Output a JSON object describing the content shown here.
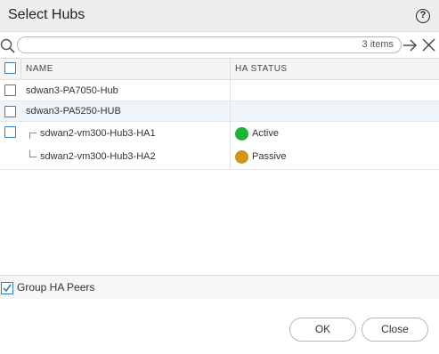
{
  "dialog": {
    "title": "Select Hubs",
    "help_glyph": "?"
  },
  "search": {
    "value": "",
    "placeholder": "",
    "count": "3 items"
  },
  "grid": {
    "columns": [
      "NAME",
      "HA STATUS"
    ],
    "rows": [
      {
        "name": "sdwan3-PA7050-Hub",
        "status": ""
      },
      {
        "name": "sdwan3-PA5250-HUB",
        "status": ""
      },
      {
        "group": true,
        "members": [
          {
            "name": "sdwan2-vm300-Hub3-HA1",
            "status": "Active",
            "status_color": "#1db33b"
          },
          {
            "name": "sdwan2-vm300-Hub3-HA2",
            "status": "Passive",
            "status_color": "#d4960f"
          }
        ]
      }
    ]
  },
  "options": {
    "group_ha_peers_label": "Group HA Peers",
    "group_ha_peers_checked": true
  },
  "buttons": {
    "ok": "OK",
    "close": "Close"
  },
  "colors": {
    "accent": "#2f7fc1",
    "active": "#1db33b",
    "passive": "#d4960f"
  }
}
